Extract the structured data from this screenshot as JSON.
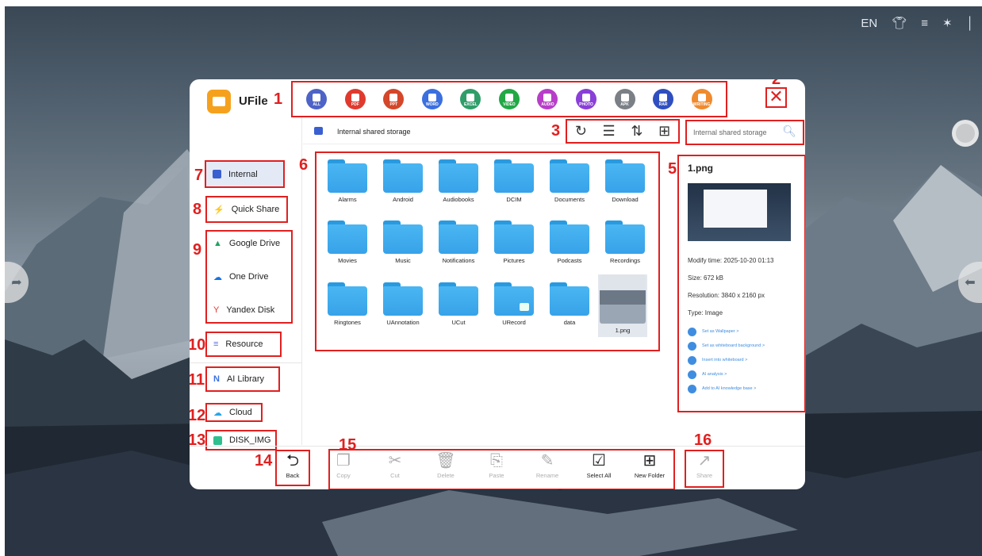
{
  "status_bar": {
    "language": "EN",
    "icons": [
      "shirt-icon",
      "wifi-icon",
      "bluetooth-icon",
      "thermometer-icon"
    ]
  },
  "app": {
    "title": "UFile"
  },
  "file_types": [
    {
      "label": "ALL",
      "color": "#4e63c7"
    },
    {
      "label": "PDF",
      "color": "#e03a2e"
    },
    {
      "label": "PPT",
      "color": "#d4472a"
    },
    {
      "label": "WORD",
      "color": "#3b6fe0"
    },
    {
      "label": "EXCEL",
      "color": "#2f9e6a"
    },
    {
      "label": "VIDEO",
      "color": "#22a845"
    },
    {
      "label": "AUDIO",
      "color": "#b83ec9"
    },
    {
      "label": "PHOTO",
      "color": "#8a3fd8"
    },
    {
      "label": "APK",
      "color": "#7b7f86"
    },
    {
      "label": "RAR",
      "color": "#2f4fc0"
    },
    {
      "label": "WRITING",
      "color": "#f08a2e"
    }
  ],
  "annotations": [
    "1",
    "2",
    "3",
    "4",
    "5",
    "6",
    "7",
    "8",
    "9",
    "10",
    "11",
    "12",
    "13",
    "14",
    "15",
    "16"
  ],
  "sidebar": {
    "internal": "Internal",
    "quick_share": "Quick Share",
    "cloud_drives": [
      "Google Drive",
      "One Drive",
      "Yandex Disk"
    ],
    "resource": "Resource",
    "ai_library": "AI Library",
    "cloud": "Cloud",
    "disk": "DISK_IMG"
  },
  "path": {
    "label": "Internal shared storage"
  },
  "search": {
    "placeholder": "Internal shared storage"
  },
  "files": [
    "Alarms",
    "Android",
    "Audiobooks",
    "DCIM",
    "Documents",
    "Download",
    "Movies",
    "Music",
    "Notifications",
    "Pictures",
    "Podcasts",
    "Recordings",
    "Ringtones",
    "UAnnotation",
    "UCut",
    "URecord",
    "data",
    "1.png"
  ],
  "details": {
    "name": "1.png",
    "modify_time": "Modify time: 2025-10-20 01:13",
    "size": "Size: 672 kB",
    "resolution": "Resolution: 3840 x 2160 px",
    "type": "Type: Image",
    "actions": [
      "Set as Wallpaper >",
      "Set as whiteboard background >",
      "Insert into whiteboard >",
      "AI analysis >",
      "Add to AI knowledge base >"
    ]
  },
  "bottom": {
    "back": "Back",
    "copy": "Copy",
    "cut": "Cut",
    "delete": "Delete",
    "paste": "Paste",
    "rename": "Rename",
    "select_all": "Select All",
    "new_folder": "New Folder",
    "share": "Share"
  }
}
